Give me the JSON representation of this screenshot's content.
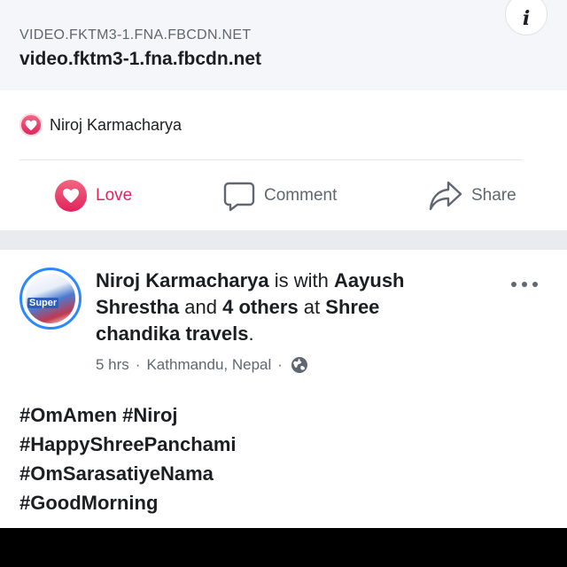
{
  "link_preview": {
    "domain_caption": "VIDEO.FKTM3-1.FNA.FBCDN.NET",
    "domain_title": "video.fktm3-1.fna.fbcdn.net",
    "info_icon": "info-icon"
  },
  "reactions": {
    "reactor_name": "Niroj Karmacharya",
    "icon": "love-reaction-icon",
    "color": "#e0245e"
  },
  "actions": {
    "love_label": "Love",
    "comment_label": "Comment",
    "share_label": "Share"
  },
  "post": {
    "author": "Niroj Karmacharya",
    "with_text": " is with ",
    "tagged_person": "Aayush Shrestha",
    "and_text": " and ",
    "others": "4 others",
    "at_text": " at ",
    "place": "Shree chandika travels",
    "period": ".",
    "time": "5 hrs",
    "location": "Kathmandu, Nepal",
    "separator": "·",
    "avatar_caption": "Super",
    "hashtag_lines": [
      "#OmAmen #Niroj",
      "#HappyShreePanchami",
      "#OmSarasatiyeNama",
      "#GoodMorning"
    ]
  },
  "colors": {
    "accent": "#2d88ff",
    "muted_text": "#606770",
    "band": "#e9ebee"
  }
}
